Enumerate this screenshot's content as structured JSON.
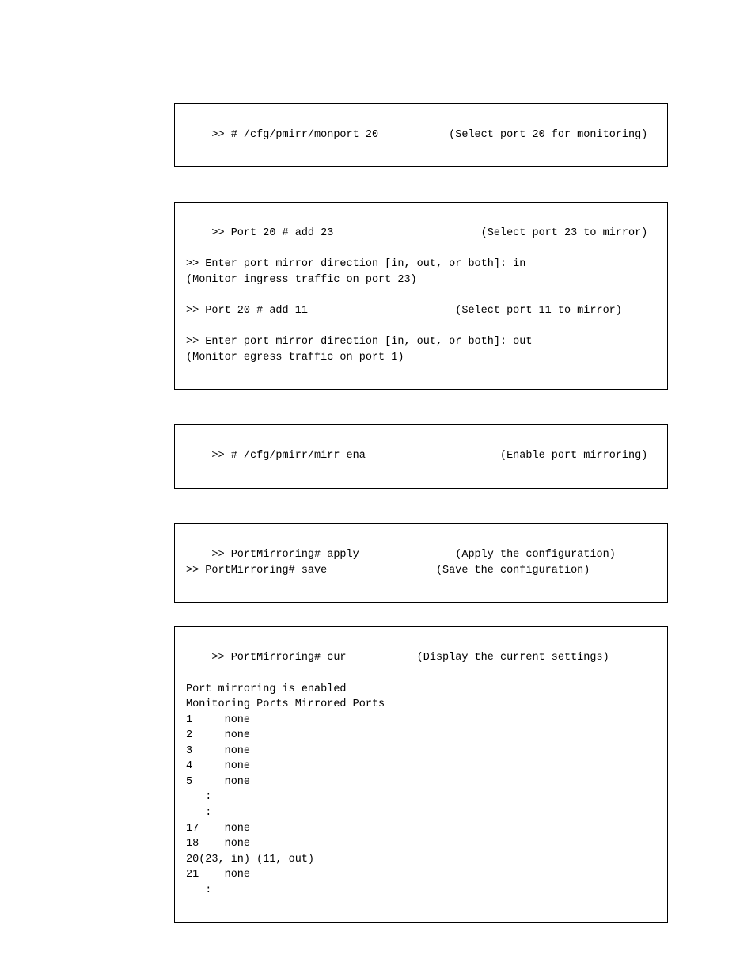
{
  "box1": ">> # /cfg/pmirr/monport 20           (Select port 20 for monitoring)",
  "box2": ">> Port 20 # add 23                       (Select port 23 to mirror)\n\n>> Enter port mirror direction [in, out, or both]: in\n(Monitor ingress traffic on port 23)\n\n>> Port 20 # add 11                       (Select port 11 to mirror)\n\n>> Enter port mirror direction [in, out, or both]: out\n(Monitor egress traffic on port 1)",
  "box3": ">> # /cfg/pmirr/mirr ena                     (Enable port mirroring)",
  "box4": ">> PortMirroring# apply               (Apply the configuration)\n>> PortMirroring# save                 (Save the configuration)",
  "box5": ">> PortMirroring# cur           (Display the current settings)\n\nPort mirroring is enabled\nMonitoring Ports Mirrored Ports\n1     none\n2     none\n3     none\n4     none\n5     none\n   :\n   :\n17    none\n18    none\n20(23, in) (11, out)\n21    none\n   :"
}
